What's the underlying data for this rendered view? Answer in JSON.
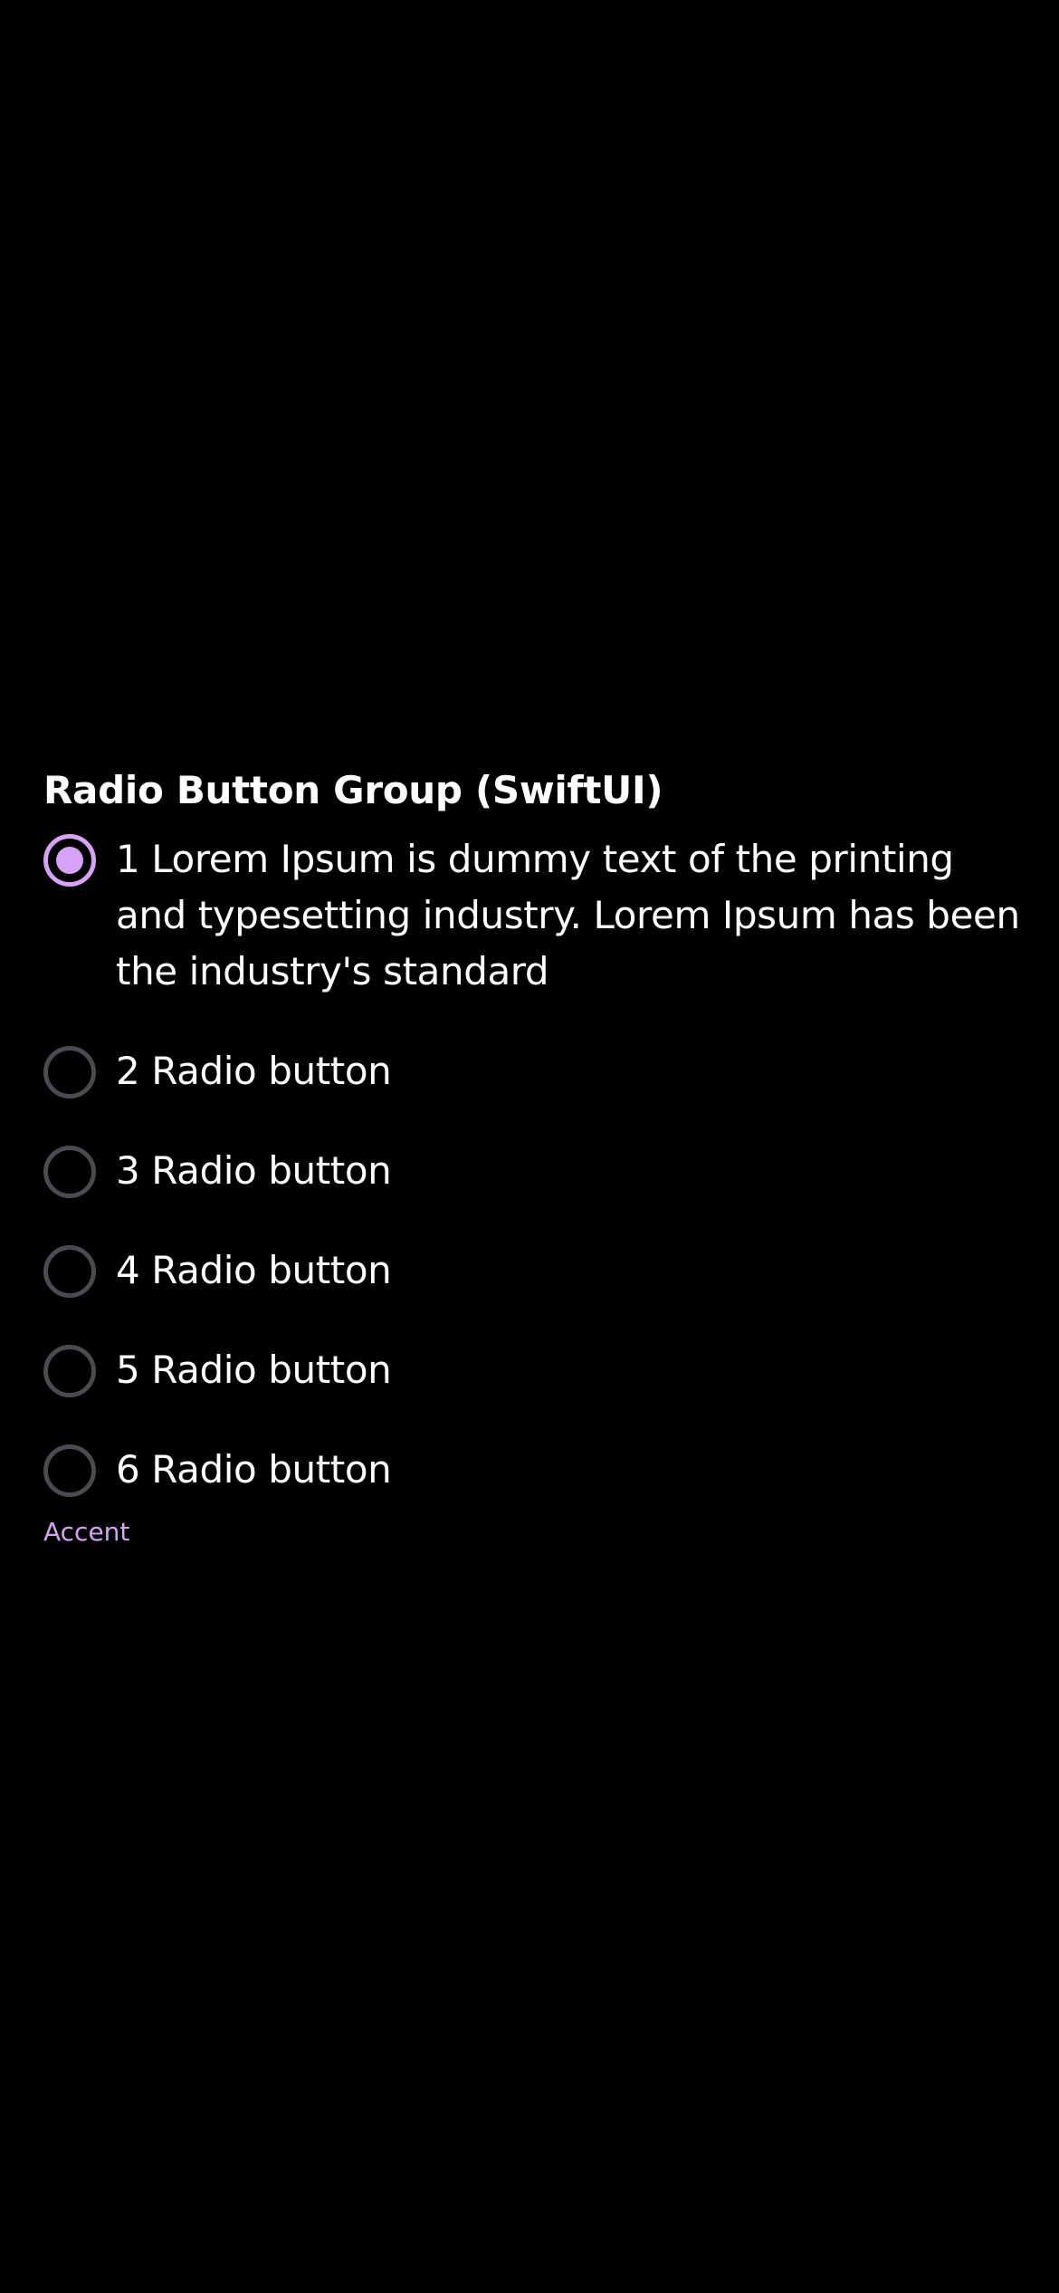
{
  "group": {
    "title": "Radio Button Group (SwiftUI)",
    "selected_index": 0,
    "items": [
      {
        "label": "1 Lorem Ipsum is dummy text of the printing and typesetting industry. Lorem Ipsum has been the industry's standard"
      },
      {
        "label": "2 Radio button"
      },
      {
        "label": "3 Radio button"
      },
      {
        "label": "4 Radio button"
      },
      {
        "label": "5 Radio button"
      },
      {
        "label": "6 Radio button"
      }
    ],
    "caption": "Accent"
  },
  "colors": {
    "background": "#000000",
    "accent": "#d6a2f5",
    "unselected_ring": "#4a4a50",
    "text": "#ffffff"
  }
}
